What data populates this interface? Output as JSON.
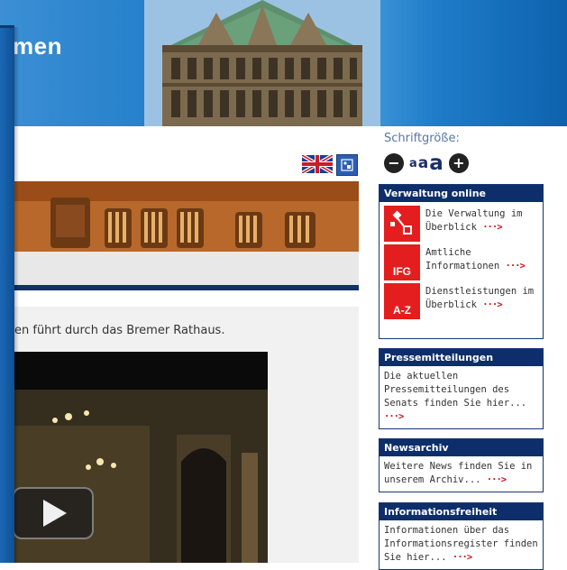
{
  "header": {
    "site_name": "men"
  },
  "language": {
    "english_flag": "en-flag-icon",
    "easy_language": "easy-language-icon"
  },
  "main": {
    "intro_text": "en führt durch das Bremer Rathaus."
  },
  "video": {
    "play_icon": "play-icon"
  },
  "sidebar": {
    "font_size": {
      "label": "Schriftgröße:",
      "small": "a",
      "medium": "a",
      "large": "a",
      "decrease_icon": "minus-icon",
      "increase_icon": "plus-icon"
    },
    "verwaltung": {
      "title": "Verwaltung online",
      "items": [
        {
          "icon": "network-icon",
          "icon_text": "",
          "line1": "Die Verwaltung im",
          "line2": "Überblick",
          "arrow": "···>"
        },
        {
          "icon": "ifg-icon",
          "icon_text": "IFG",
          "line1": "Amtliche",
          "line2": "Informationen",
          "arrow": "···>"
        },
        {
          "icon": "az-icon",
          "icon_text": "A-Z",
          "line1": "Dienstleistungen im",
          "line2": "Überblick",
          "arrow": "···>"
        }
      ]
    },
    "presse": {
      "title": "Pressemitteilungen",
      "text": "Die aktuellen Pressemitteilungen des Senats finden Sie hier...",
      "arrow": "···>"
    },
    "newsarchiv": {
      "title": "Newsarchiv",
      "text": "Weitere News finden Sie in unserem Archiv...",
      "arrow": "···>"
    },
    "informationsfreiheit": {
      "title": "Informationsfreiheit",
      "text": "Informationen über das Informationsregister finden Sie hier...",
      "arrow": "···>"
    }
  },
  "colors": {
    "header_blue": "#1577c5",
    "box_navy": "#0d2e6a",
    "link_red": "#d0111b",
    "service_red": "#e41e1e"
  }
}
